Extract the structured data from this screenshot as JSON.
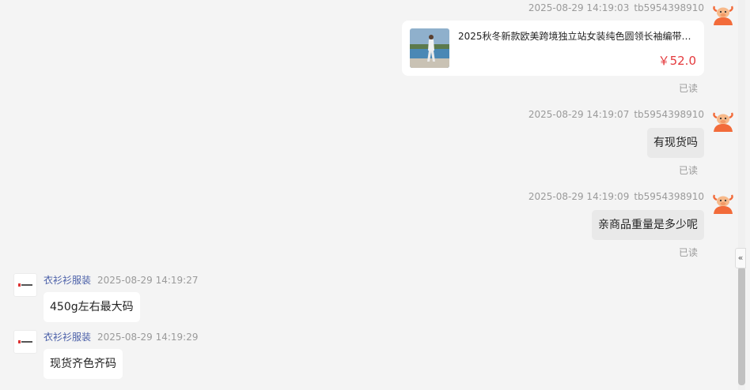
{
  "messages": [
    {
      "time": "2025-08-29 14:19:03",
      "user": "tb5954398910",
      "type": "product",
      "product_title": "2025秋冬新款欧美跨境独立站女装纯色圆领长袖编带拼...",
      "price": "￥52.0",
      "status": "已读"
    },
    {
      "time": "2025-08-29 14:19:07",
      "user": "tb5954398910",
      "text": "有现货吗",
      "status": "已读"
    },
    {
      "time": "2025-08-29 14:19:09",
      "user": "tb5954398910",
      "text": "亲商品重量是多少呢",
      "status": "已读"
    },
    {
      "shop": "衣衫衫服装",
      "time": "2025-08-29 14:19:27",
      "text": "450g左右最大码"
    },
    {
      "shop": "衣衫衫服装",
      "time": "2025-08-29 14:19:29",
      "text": "现货齐色齐码"
    }
  ],
  "icons": {
    "customer_avatar": "bull-mascot-avatar-icon",
    "shop_avatar": "shop-logo-icon",
    "collapse": "double-chevron-left-icon"
  },
  "colors": {
    "background": "#f4f4f4",
    "price": "#e4393c",
    "shop_name": "#4a5fa8",
    "outgoing_bubble": "#e9e9e9",
    "incoming_bubble": "#ffffff",
    "avatar_orange": "#f26b3a"
  },
  "collapse_glyph": "«"
}
